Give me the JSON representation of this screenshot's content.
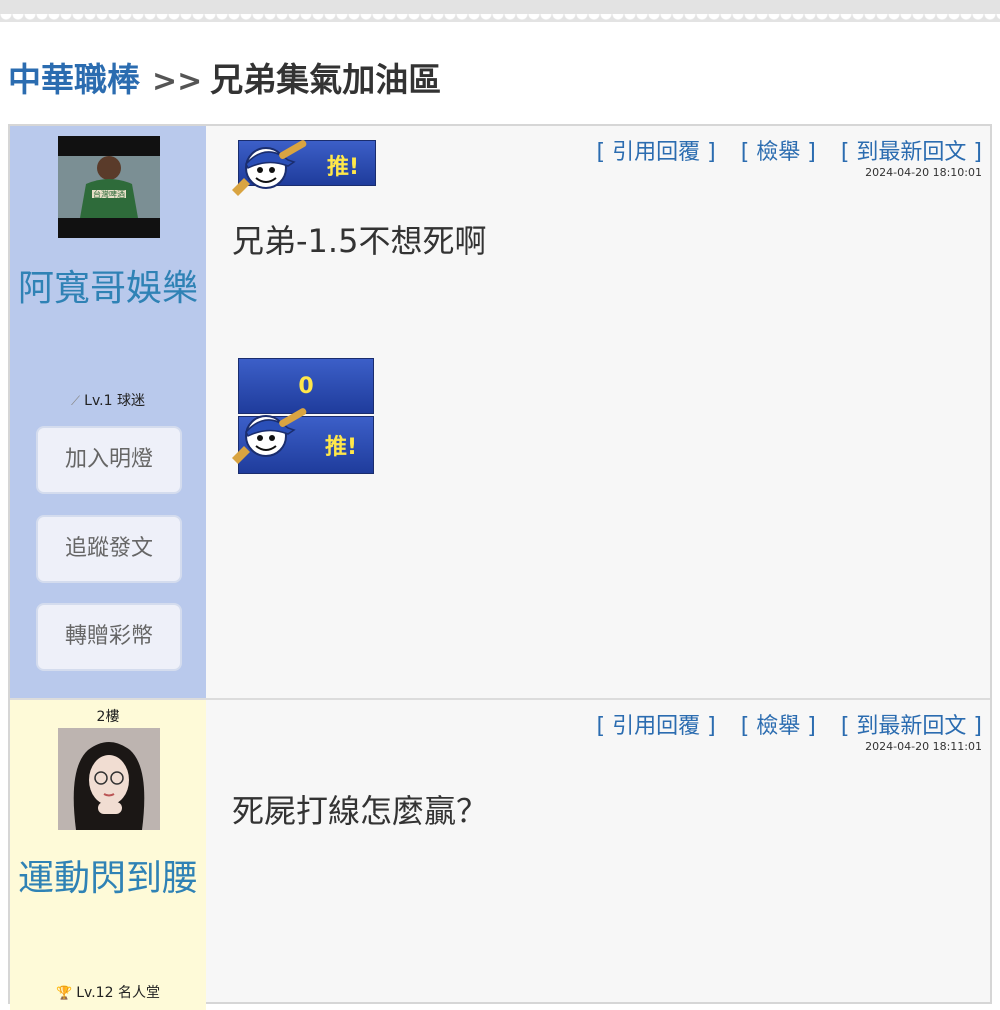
{
  "breadcrumb": {
    "forum": "中華職棒",
    "separator": ">>",
    "board": "兄弟集氣加油區"
  },
  "colors": {
    "accent": "#2b6cb0",
    "username": "#2f82b5",
    "post1_sidebar": "#b9c9ec",
    "post2_sidebar": "#fefad8",
    "push_yellow": "#ffe74a"
  },
  "posts": [
    {
      "floor": "",
      "username": "阿寬哥娛樂",
      "level_icon": "bat-icon",
      "level": "Lv.1 球迷",
      "buttons": [
        "加入明燈",
        "追蹤發文",
        "轉贈彩幣"
      ],
      "actions": [
        "[ 引用回覆 ]",
        "[ 檢舉 ]",
        "[ 到最新回文 ]"
      ],
      "timestamp": "2024-04-20 18:10:01",
      "push_label": "推!",
      "content": "兄弟-1.5不想死啊",
      "vote_count": "0",
      "vote_push_label": "推!"
    },
    {
      "floor": "2樓",
      "username": "運動閃到腰",
      "level_icon": "trophy-icon",
      "level": "Lv.12 名人堂",
      "actions": [
        "[ 引用回覆 ]",
        "[ 檢舉 ]",
        "[ 到最新回文 ]"
      ],
      "timestamp": "2024-04-20 18:11:01",
      "content": "死屍打線怎麼贏？"
    }
  ]
}
